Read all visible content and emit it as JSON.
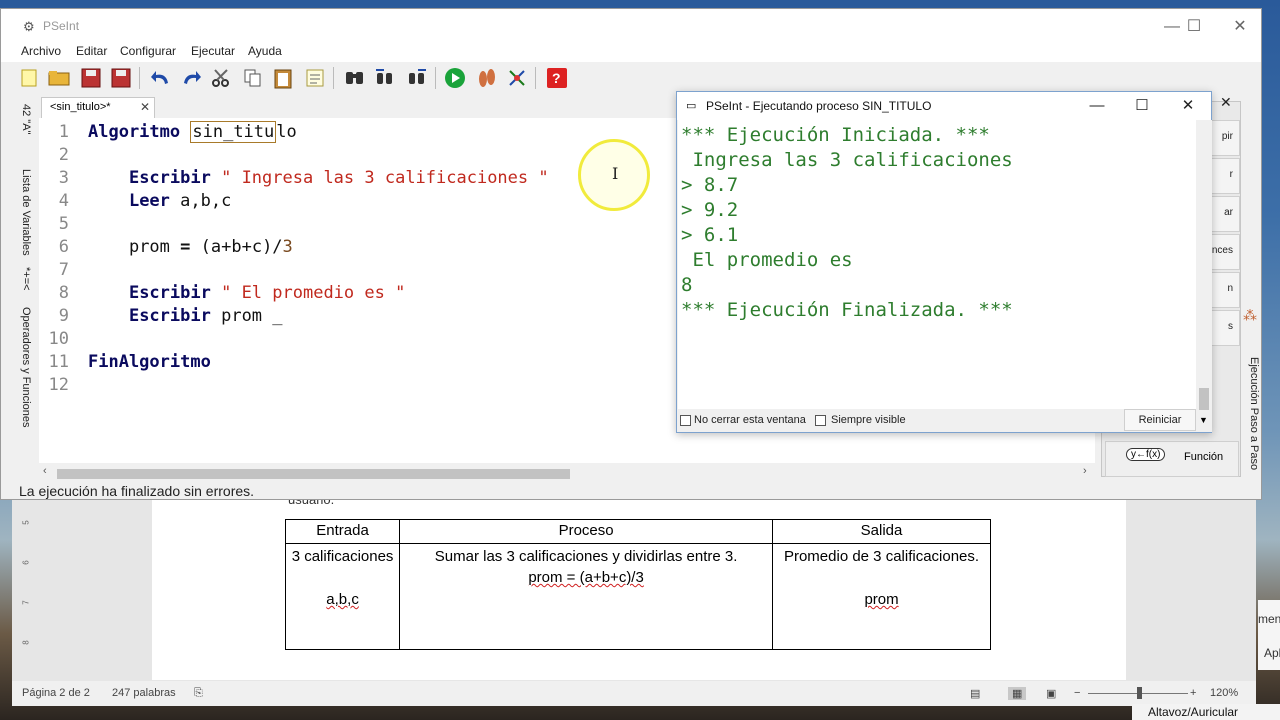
{
  "pseint": {
    "title": "PSeInt",
    "menu": [
      "Archivo",
      "Editar",
      "Configurar",
      "Ejecutar",
      "Ayuda"
    ],
    "tab_label": "<sin_titulo>*",
    "left_panels": [
      "Lista de Variables",
      "Operadores y Funciones"
    ],
    "left_panel_symbols": [
      "*+=<",
      "42 \"A\""
    ],
    "right_panel_label": "Ejecución Paso a Paso",
    "right_panel_items": [
      "pir",
      "r",
      "ar",
      "nces",
      "n",
      "s"
    ],
    "funcion_label": "Función",
    "funcion_icon_text": "y←f(x)",
    "status": "La ejecución ha finalizado sin errores."
  },
  "code": {
    "lines": [
      {
        "n": "1",
        "t": "Algoritmo sin_titulo"
      },
      {
        "n": "2",
        "t": ""
      },
      {
        "n": "3",
        "t": "    Escribir \" Ingresa las 3 calificaciones \""
      },
      {
        "n": "4",
        "t": "    Leer a,b,c"
      },
      {
        "n": "5",
        "t": ""
      },
      {
        "n": "6",
        "t": "    prom = (a+b+c)/3"
      },
      {
        "n": "7",
        "t": ""
      },
      {
        "n": "8",
        "t": "    Escribir \" El promedio es \""
      },
      {
        "n": "9",
        "t": "    Escribir prom _"
      },
      {
        "n": "10",
        "t": ""
      },
      {
        "n": "11",
        "t": "FinAlgoritmo"
      },
      {
        "n": "12",
        "t": ""
      }
    ],
    "kw_algoritmo": "Algoritmo",
    "name": "sin_titu",
    "name_rest": "lo",
    "kw_escribir": "Escribir",
    "str1": "\" Ingresa las 3 calificaciones \"",
    "kw_leer": "Leer",
    "vars": "a,b,c",
    "prom": "prom",
    "eq": "=",
    "expr": "(a+b+c)/",
    "three": "3",
    "str2": "\" El promedio es \"",
    "prom_cursor": "prom _",
    "kw_fin": "FinAlgoritmo"
  },
  "exec": {
    "title": "PSeInt - Ejecutando proceso SIN_TITULO",
    "lines": [
      "*** Ejecución Iniciada. ***",
      " Ingresa las 3 calificaciones",
      "> 8.7",
      "> 9.2",
      "> 6.1",
      " El promedio es",
      "8",
      "*** Ejecución Finalizada. ***"
    ],
    "no_cerrar": "No cerrar esta ventana",
    "siempre_visible": "Siempre visible",
    "reiniciar": "Reiniciar"
  },
  "word": {
    "headers": [
      "Entrada",
      "Proceso",
      "Salida"
    ],
    "row1": [
      "3 calificaciones",
      "Sumar las 3 calificaciones y dividirlas entre 3.",
      "Promedio de 3 calificaciones."
    ],
    "row2": [
      "a,b,c",
      "prom = (a+b+c)/3",
      "prom"
    ],
    "status_page": "Página 2 de 2",
    "status_words": "247 palabras",
    "zoom": "120%",
    "top_fragment": "usuario."
  },
  "taskbar": {
    "audio": "Altavoz/Auricular",
    "side_fragments": [
      "men",
      "Apl"
    ]
  },
  "colors": {
    "keyword": "#0a0a5e",
    "string": "#c0291e",
    "console_text": "#2e7d2e",
    "highlight_ring": "#f1eb3c"
  }
}
